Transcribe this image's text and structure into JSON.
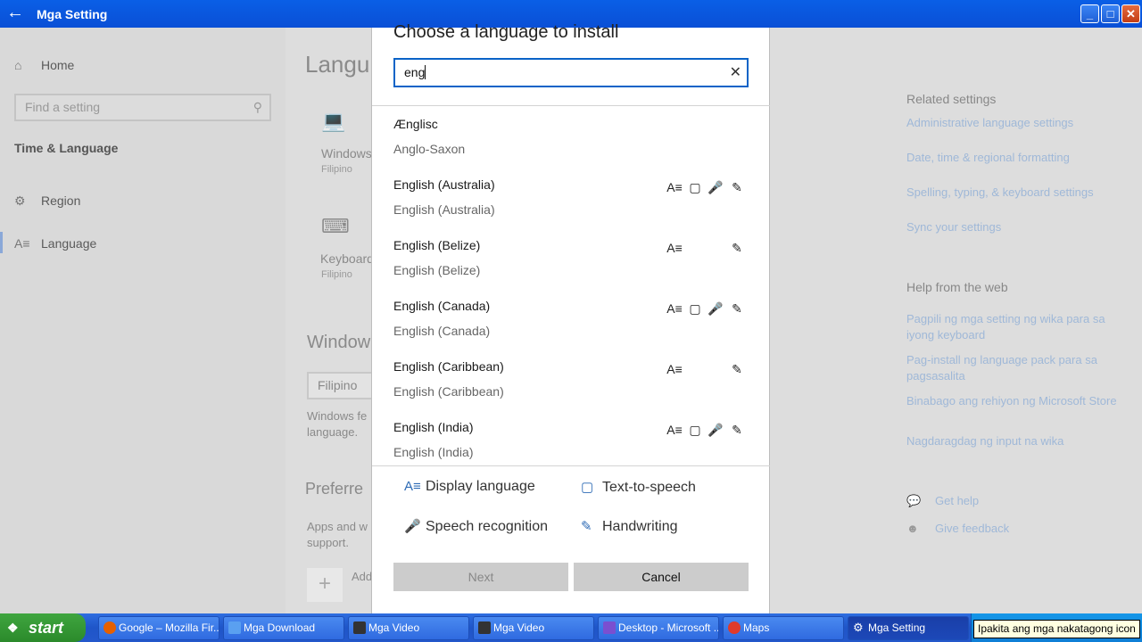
{
  "window": {
    "title": "Mga Setting",
    "back_icon": "back-arrow-icon"
  },
  "sidebar": {
    "home": "Home",
    "search_placeholder": "Find a setting",
    "section": "Time & Language",
    "items": [
      {
        "label": "Region",
        "icon": "globe-icon"
      },
      {
        "label": "Language",
        "icon": "language-icon"
      }
    ]
  },
  "main": {
    "heading_partial": "Langu",
    "windows_item": "Windows",
    "windows_sub": "Filipino",
    "keyboard_item": "Keyboard",
    "keyboard_sub": "Filipino",
    "windows_section": "Window",
    "filipino_select": "Filipino",
    "windows_fe_line1": "Windows fe",
    "windows_fe_line2": "language.",
    "preferred": "Preferre",
    "apps_line1": "Apps and w",
    "apps_line2": "support.",
    "add": "Add"
  },
  "related": {
    "heading": "Related settings",
    "links": [
      "Administrative language settings",
      "Date, time & regional formatting",
      "Spelling, typing, & keyboard settings",
      "Sync your settings"
    ],
    "help_heading": "Help from the web",
    "help_links": [
      "Pagpili ng mga setting ng wika para sa iyong keyboard",
      "Pag-install ng language pack para sa pagsasalita",
      "Binabago ang rehiyon ng Microsoft Store",
      "Nagdaragdag ng input na wika"
    ],
    "get_help": "Get help",
    "give_feedback": "Give feedback"
  },
  "dialog": {
    "title": "Choose a language to install",
    "search_value": "eng",
    "languages": [
      {
        "name": "Ænglisc",
        "native": "Anglo-Saxon",
        "features": []
      },
      {
        "name": "English (Australia)",
        "native": "English (Australia)",
        "features": [
          "display",
          "tts",
          "speech",
          "handwriting"
        ]
      },
      {
        "name": "English (Belize)",
        "native": "English (Belize)",
        "features": [
          "display",
          "handwriting"
        ]
      },
      {
        "name": "English (Canada)",
        "native": "English (Canada)",
        "features": [
          "display",
          "tts",
          "speech",
          "handwriting"
        ]
      },
      {
        "name": "English (Caribbean)",
        "native": "English (Caribbean)",
        "features": [
          "display",
          "handwriting"
        ]
      },
      {
        "name": "English (India)",
        "native": "English (India)",
        "features": [
          "display",
          "tts",
          "speech",
          "handwriting"
        ]
      }
    ],
    "legend": {
      "display": "Display language",
      "tts": "Text-to-speech",
      "speech": "Speech recognition",
      "handwriting": "Handwriting"
    },
    "next": "Next",
    "cancel": "Cancel"
  },
  "taskbar": {
    "start": "start",
    "tasks": [
      "Google – Mozilla Fir...",
      "Mga Download",
      "Mga Video",
      "Mga Video",
      "Desktop - Microsoft ...",
      "Maps",
      "Mga Setting"
    ],
    "tooltip": "Ipakita ang mga nakatagong icon"
  }
}
